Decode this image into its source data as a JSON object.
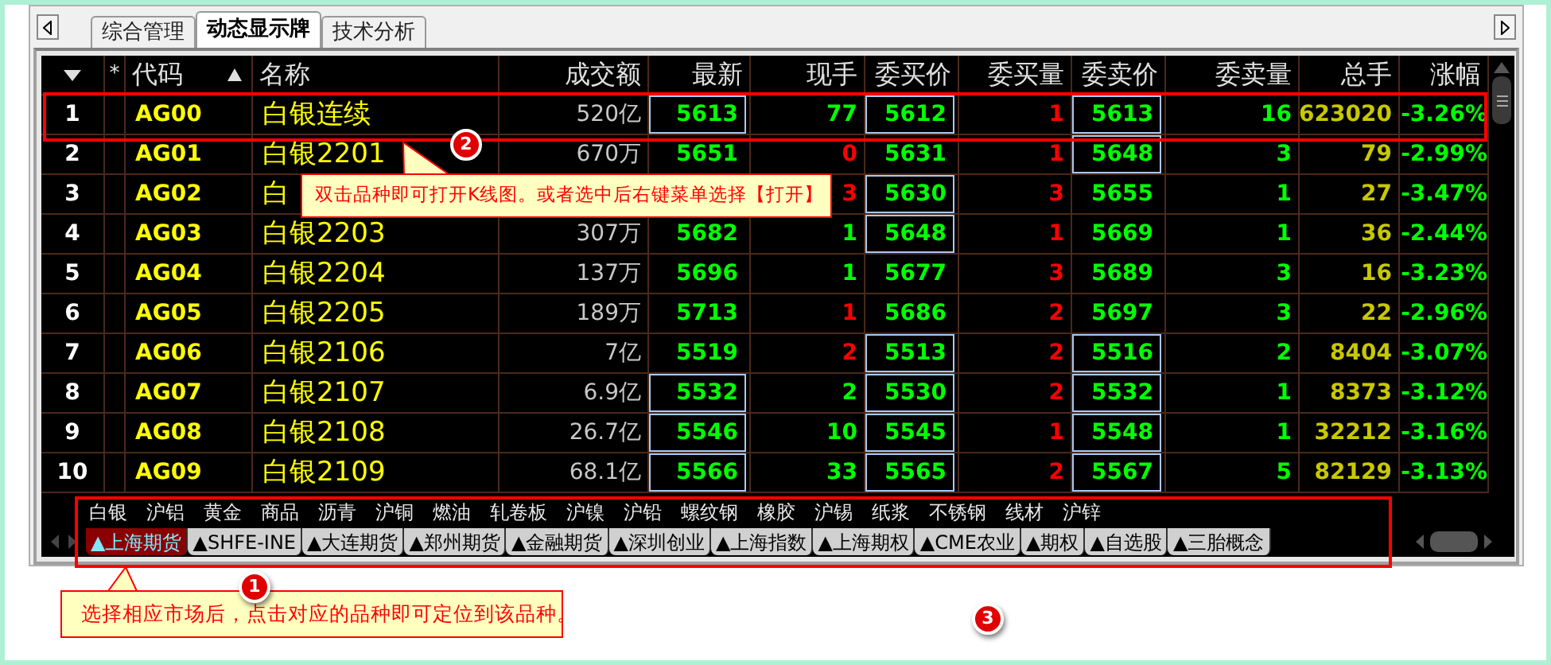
{
  "top_tabs": [
    {
      "label": "综合管理",
      "selected": false
    },
    {
      "label": "动态显示牌",
      "selected": true
    },
    {
      "label": "技术分析",
      "selected": false
    }
  ],
  "table": {
    "columns": [
      {
        "kind": "index"
      },
      {
        "kind": "flag",
        "label": "*"
      },
      {
        "kind": "code",
        "label": "代码"
      },
      {
        "kind": "name",
        "label": "名称"
      },
      {
        "kind": "amount",
        "label": "成交额"
      },
      {
        "kind": "last",
        "label": "最新"
      },
      {
        "kind": "vol",
        "label": "现手"
      },
      {
        "kind": "bid",
        "label": "委买价"
      },
      {
        "kind": "bid_vol",
        "label": "委买量"
      },
      {
        "kind": "ask",
        "label": "委卖价"
      },
      {
        "kind": "ask_vol",
        "label": "委卖量"
      },
      {
        "kind": "total",
        "label": "总手"
      },
      {
        "kind": "change",
        "label": "涨幅"
      }
    ],
    "rows": [
      {
        "no": "1",
        "code": "AG00",
        "name": "白银连续",
        "amount": "520亿",
        "last": {
          "text": "5613",
          "boxed": true
        },
        "vol": {
          "text": "77",
          "color": "#00ff00"
        },
        "bid": {
          "text": "5612",
          "boxed": true
        },
        "bid_vol": {
          "text": "1",
          "color": "#ff0000"
        },
        "ask": {
          "text": "5613",
          "boxed": true
        },
        "ask_vol": "16",
        "total": "623020",
        "change": "-3.26%"
      },
      {
        "no": "2",
        "code": "AG01",
        "name": "白银2201",
        "amount": "670万",
        "last": {
          "text": "5651",
          "boxed": false
        },
        "vol": {
          "text": "0",
          "color": "#ff0000"
        },
        "bid": {
          "text": "5631",
          "boxed": false
        },
        "bid_vol": {
          "text": "1",
          "color": "#ff0000"
        },
        "ask": {
          "text": "5648",
          "boxed": true
        },
        "ask_vol": "3",
        "total": "79",
        "change": "-2.99%"
      },
      {
        "no": "3",
        "code": "AG02",
        "name": "白",
        "vol": {
          "text": "3",
          "color": "#ff0000"
        },
        "bid": {
          "text": "5630",
          "boxed": true
        },
        "bid_vol": {
          "text": "3",
          "color": "#ff0000"
        },
        "ask": {
          "text": "5655",
          "boxed": false
        },
        "ask_vol": "1",
        "total": "27",
        "change": "-3.47%"
      },
      {
        "no": "4",
        "code": "AG03",
        "name": "白银2203",
        "amount": "307万",
        "last": {
          "text": "5682",
          "boxed": false
        },
        "vol": {
          "text": "1",
          "color": "#00ff00"
        },
        "bid": {
          "text": "5648",
          "boxed": true
        },
        "bid_vol": {
          "text": "1",
          "color": "#ff0000"
        },
        "ask": {
          "text": "5669",
          "boxed": false
        },
        "ask_vol": "1",
        "total": "36",
        "change": "-2.44%"
      },
      {
        "no": "5",
        "code": "AG04",
        "name": "白银2204",
        "amount": "137万",
        "last": {
          "text": "5696",
          "boxed": false
        },
        "vol": {
          "text": "1",
          "color": "#00ff00"
        },
        "bid": {
          "text": "5677",
          "boxed": false
        },
        "bid_vol": {
          "text": "3",
          "color": "#ff0000"
        },
        "ask": {
          "text": "5689",
          "boxed": false
        },
        "ask_vol": "3",
        "total": "16",
        "change": "-3.23%"
      },
      {
        "no": "6",
        "code": "AG05",
        "name": "白银2205",
        "amount": "189万",
        "last": {
          "text": "5713",
          "boxed": false
        },
        "vol": {
          "text": "1",
          "color": "#ff0000"
        },
        "bid": {
          "text": "5686",
          "boxed": false
        },
        "bid_vol": {
          "text": "2",
          "color": "#ff0000"
        },
        "ask": {
          "text": "5697",
          "boxed": false
        },
        "ask_vol": "3",
        "total": "22",
        "change": "-2.96%"
      },
      {
        "no": "7",
        "code": "AG06",
        "name": "白银2106",
        "amount": "7亿",
        "last": {
          "text": "5519",
          "boxed": false
        },
        "vol": {
          "text": "2",
          "color": "#ff0000"
        },
        "bid": {
          "text": "5513",
          "boxed": true
        },
        "bid_vol": {
          "text": "2",
          "color": "#ff0000"
        },
        "ask": {
          "text": "5516",
          "boxed": true
        },
        "ask_vol": "2",
        "total": "8404",
        "change": "-3.07%"
      },
      {
        "no": "8",
        "code": "AG07",
        "name": "白银2107",
        "amount": "6.9亿",
        "last": {
          "text": "5532",
          "boxed": true
        },
        "vol": {
          "text": "2",
          "color": "#00ff00"
        },
        "bid": {
          "text": "5530",
          "boxed": true
        },
        "bid_vol": {
          "text": "2",
          "color": "#ff0000"
        },
        "ask": {
          "text": "5532",
          "boxed": true
        },
        "ask_vol": "1",
        "total": "8373",
        "change": "-3.12%"
      },
      {
        "no": "9",
        "code": "AG08",
        "name": "白银2108",
        "amount": "26.7亿",
        "last": {
          "text": "5546",
          "boxed": true
        },
        "vol": {
          "text": "10",
          "color": "#00ff00"
        },
        "bid": {
          "text": "5545",
          "boxed": true
        },
        "bid_vol": {
          "text": "1",
          "color": "#ff0000"
        },
        "ask": {
          "text": "5548",
          "boxed": true
        },
        "ask_vol": "1",
        "total": "32212",
        "change": "-3.16%"
      },
      {
        "no": "10",
        "code": "AG09",
        "name": "白银2109",
        "amount": "68.1亿",
        "last": {
          "text": "5566",
          "boxed": true
        },
        "vol": {
          "text": "33",
          "color": "#00ff00"
        },
        "bid": {
          "text": "5565",
          "boxed": true
        },
        "bid_vol": {
          "text": "2",
          "color": "#ff0000"
        },
        "ask": {
          "text": "5567",
          "boxed": true
        },
        "ask_vol": "5",
        "total": "82129",
        "change": "-3.13%"
      }
    ]
  },
  "categories": [
    "白银",
    "沪铝",
    "黄金",
    "商品",
    "沥青",
    "沪铜",
    "燃油",
    "轧卷板",
    "沪镍",
    "沪铅",
    "螺纹钢",
    "橡胶",
    "沪锡",
    "纸浆",
    "不锈钢",
    "线材",
    "沪锌"
  ],
  "market_tabs": [
    {
      "label": "▲上海期货",
      "selected": true
    },
    {
      "label": "▲SHFE-INE",
      "selected": false
    },
    {
      "label": "▲大连期货",
      "selected": false
    },
    {
      "label": "▲郑州期货",
      "selected": false
    },
    {
      "label": "▲金融期货",
      "selected": false
    },
    {
      "label": "▲深圳创业",
      "selected": false
    },
    {
      "label": "▲上海指数",
      "selected": false
    },
    {
      "label": "▲上海期权",
      "selected": false
    },
    {
      "label": "▲CME农业",
      "selected": false
    },
    {
      "label": "▲期权",
      "selected": false
    },
    {
      "label": "▲自选股",
      "selected": false
    },
    {
      "label": "▲三胎概念",
      "selected": false
    }
  ],
  "annotations": [
    {
      "badge": "2",
      "text": "双击品种即可打开K线图。或者选中后右键菜单选择【打开】"
    },
    {
      "badge": "1",
      "text": "选择相应市场后，点击对应的品种即可定位到该品种。"
    },
    {
      "badge": "3"
    }
  ]
}
